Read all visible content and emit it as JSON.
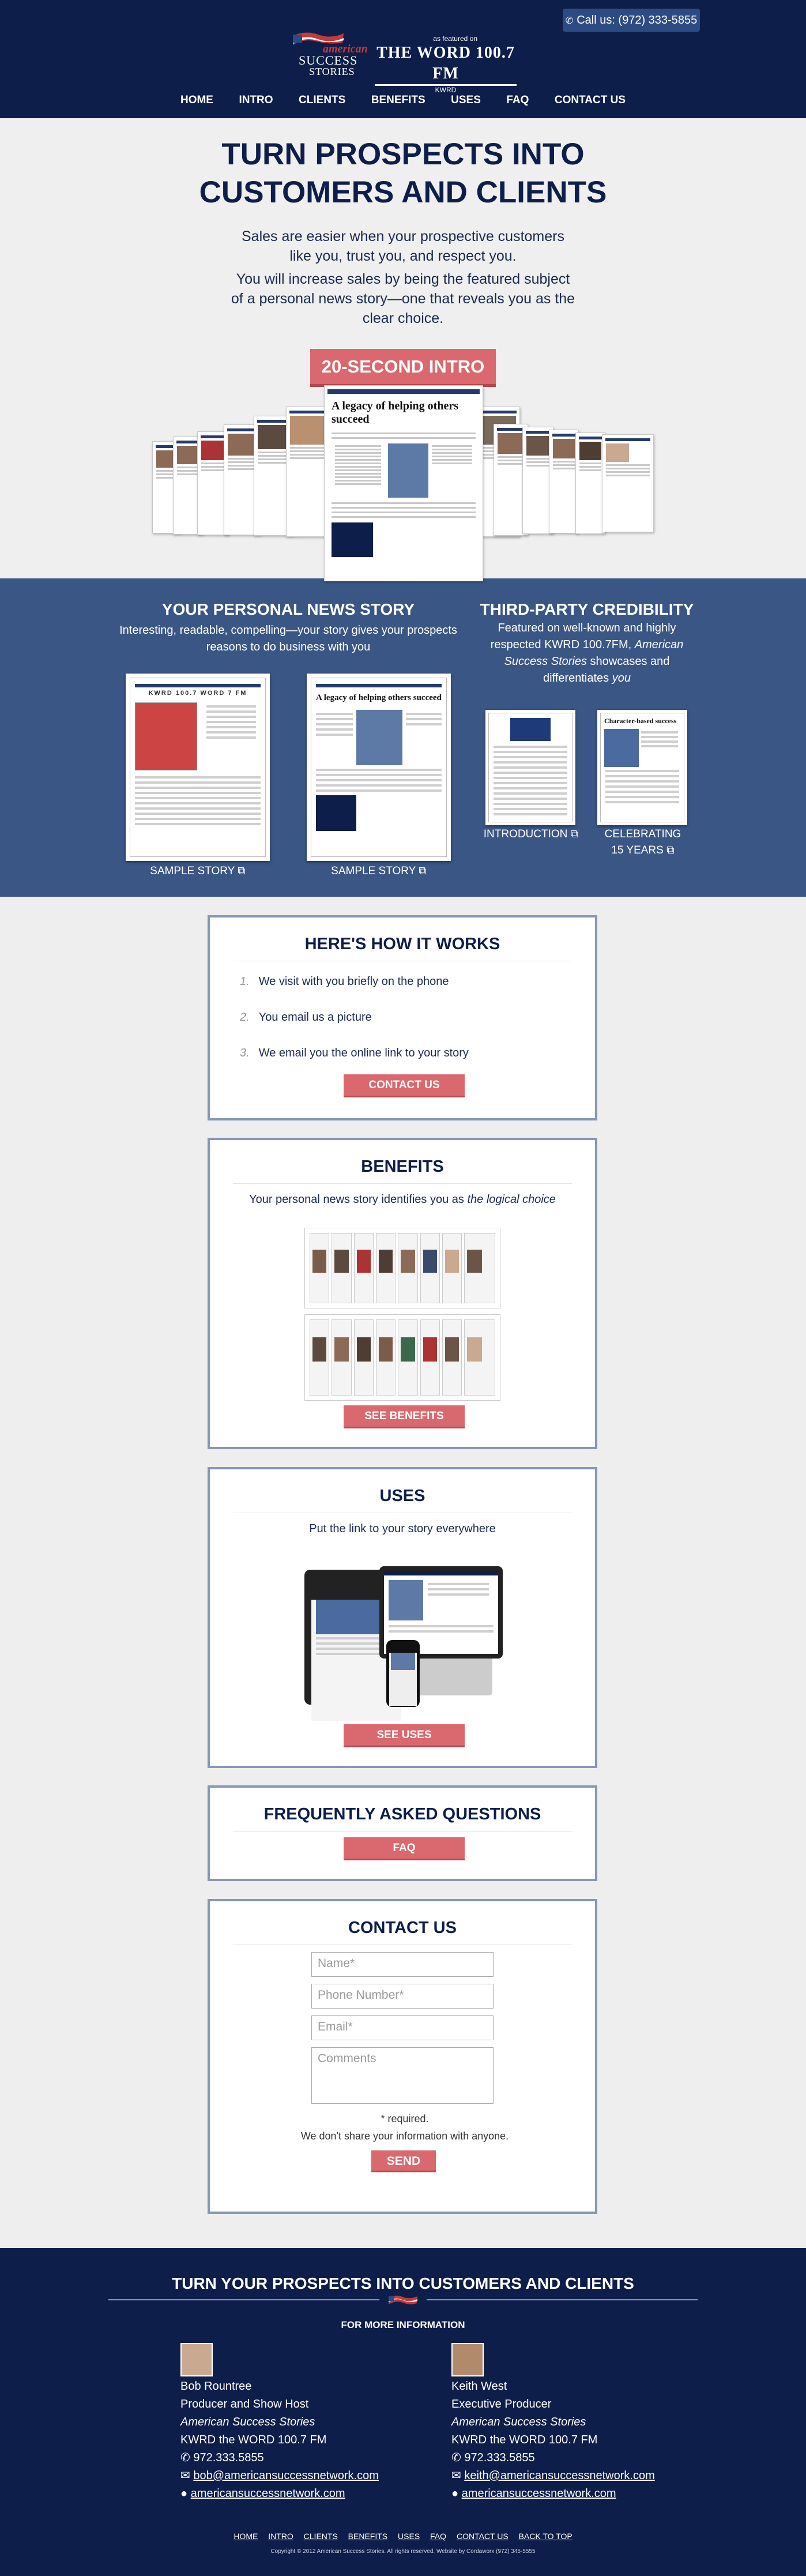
{
  "header": {
    "call_label": "Call us: (972) 333-5855",
    "logo_top": "american",
    "logo_mid": "SUCCESS",
    "logo_bot": "STORIES",
    "word_featured": "as featured on",
    "word_name": "THE WORD 100.7 FM",
    "word_call": "KWRD"
  },
  "nav": [
    "HOME",
    "INTRO",
    "CLIENTS",
    "BENEFITS",
    "USES",
    "FAQ",
    "CONTACT US"
  ],
  "hero": {
    "title_line1": "TURN PROSPECTS INTO",
    "title_line2": "CUSTOMERS AND CLIENTS",
    "p1": "Sales are easier when your prospective customers like you, trust you, and respect you.",
    "p2": "You will increase sales by being the featured subject of a personal news story—one that reveals you as the clear choice.",
    "intro_button": "20-SECOND INTRO",
    "center_headline": "A legacy of helping others succeed"
  },
  "band": {
    "left_title": "YOUR PERSONAL NEWS STORY",
    "left_sub": "Interesting, readable, compelling—your story gives your prospects reasons to do business with you",
    "sample1_caption": "SAMPLE STORY",
    "sample2_caption": "SAMPLE STORY",
    "sample2_headline": "A legacy of helping others succeed",
    "sample1_mast": "KWRD 100.7 WORD 7 FM",
    "right_title": "THIRD-PARTY CREDIBILITY",
    "right_sub_1": "Featured on well-known and highly respected KWRD 100.7FM, ",
    "right_sub_em": "American Success Stories",
    "right_sub_2": " showcases and differentiates ",
    "right_sub_you": "you",
    "intro_caption": "INTRODUCTION",
    "celebrating_caption_1": "CELEBRATING",
    "celebrating_caption_2": "15 YEARS",
    "celebrating_headline": "Character-based success"
  },
  "how": {
    "title": "HERE'S HOW IT WORKS",
    "steps": [
      {
        "num": "1.",
        "text": "We visit with you briefly on the phone"
      },
      {
        "num": "2.",
        "text": "You email us a picture"
      },
      {
        "num": "3.",
        "text": "We email you the online link to your story"
      }
    ],
    "button": "CONTACT US"
  },
  "benefits": {
    "title": "BENEFITS",
    "lead_1": "Your personal news story identifies you as ",
    "lead_em": "the logical choice",
    "button": "SEE BENEFITS"
  },
  "uses": {
    "title": "USES",
    "lead": "Put the link to your story everywhere",
    "button": "SEE USES"
  },
  "faq": {
    "title": "FREQUENTLY ASKED QUESTIONS",
    "button": "FAQ"
  },
  "contact_form": {
    "title": "CONTACT US",
    "name_ph": "Name*",
    "phone_ph": "Phone Number*",
    "email_ph": "Email*",
    "comments_ph": "Comments",
    "required_note": "* required.",
    "privacy_note": "We don't share your information with anyone.",
    "send": "SEND"
  },
  "footer": {
    "title": "TURN YOUR PROSPECTS INTO CUSTOMERS AND CLIENTS",
    "more_info": "FOR MORE INFORMATION",
    "people": [
      {
        "name": "Bob Rountree",
        "role": "Producer and Show Host",
        "show": "American Success Stories",
        "station": "KWRD the WORD 100.7 FM",
        "phone": "972.333.5855",
        "email": "bob@americansuccessnetwork.com",
        "site": "americansuccessnetwork.com"
      },
      {
        "name": "Keith West",
        "role": "Executive Producer",
        "show": "American Success Stories",
        "station": "KWRD the WORD 100.7 FM",
        "phone": "972.333.5855",
        "email": "keith@americansuccessnetwork.com",
        "site": "americansuccessnetwork.com"
      }
    ],
    "nav": [
      "HOME",
      "INTRO",
      "CLIENTS",
      "BENEFITS",
      "USES",
      "FAQ",
      "CONTACT US",
      "BACK TO TOP"
    ],
    "copyright": "Copyright © 2012 American Success Stories. All rights reserved. Website by Cordaworx (972) 345-5555"
  },
  "colors": {
    "navy": "#0d1e4a",
    "band_blue": "#3a5685",
    "accent_pink": "#d9696e",
    "card_border": "#8797b6"
  },
  "icons": {
    "phone": "phone-icon",
    "external": "external-link-icon",
    "mail": "mail-icon",
    "globe": "globe-icon"
  }
}
